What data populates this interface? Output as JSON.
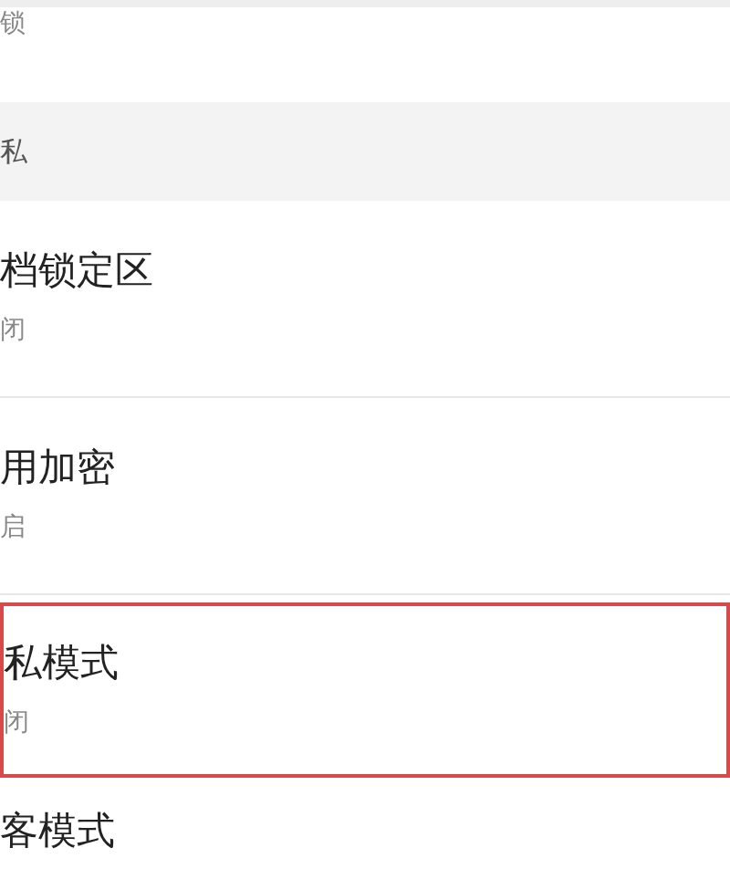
{
  "top_item": {
    "subtitle": "锁"
  },
  "section": {
    "title": "私"
  },
  "items": [
    {
      "title": "档锁定区",
      "subtitle": "闭",
      "highlighted": false
    },
    {
      "title": "用加密",
      "subtitle": "启",
      "highlighted": false
    },
    {
      "title": "私模式",
      "subtitle": "闭",
      "highlighted": true
    }
  ],
  "bottom_item": {
    "title": "客模式"
  }
}
